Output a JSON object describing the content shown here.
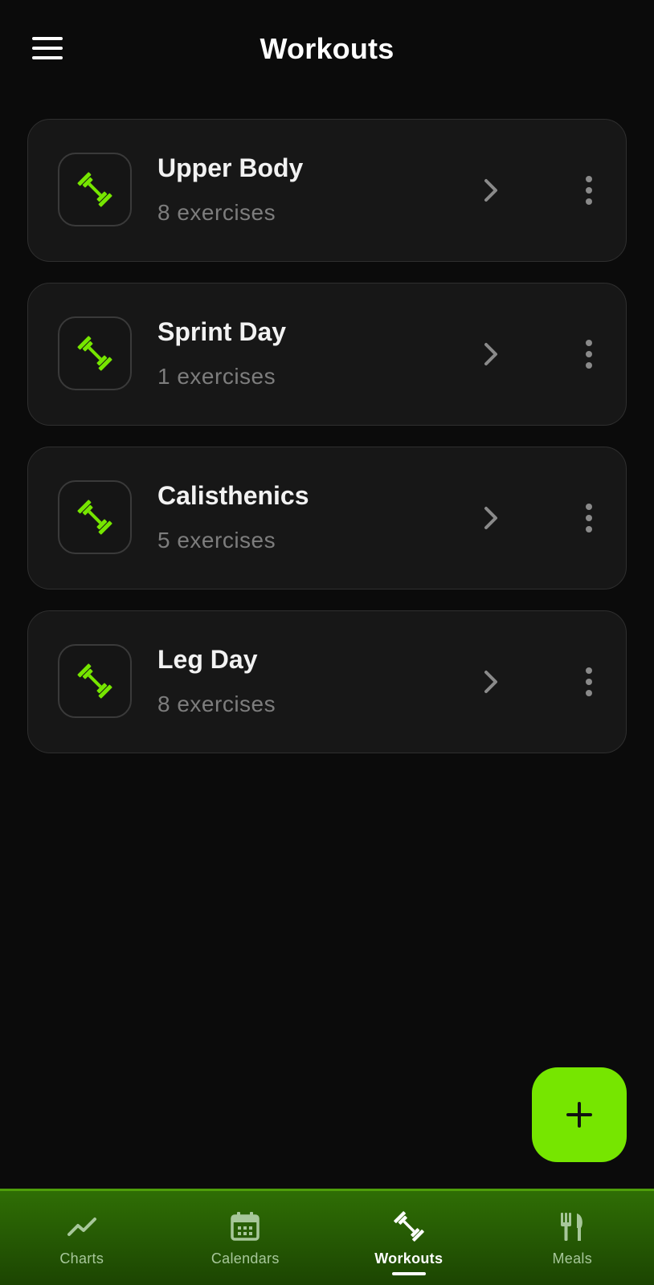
{
  "header": {
    "title": "Workouts",
    "menu_icon": "hamburger-menu-icon"
  },
  "workouts": [
    {
      "name": "Upper Body",
      "subtitle": "8 exercises"
    },
    {
      "name": "Sprint Day",
      "subtitle": "1 exercises"
    },
    {
      "name": "Calisthenics",
      "subtitle": "5 exercises"
    },
    {
      "name": "Leg Day",
      "subtitle": "8 exercises"
    }
  ],
  "fab": {
    "icon": "plus-icon"
  },
  "nav": {
    "items": [
      {
        "label": "Charts",
        "icon": "chart-line-icon"
      },
      {
        "label": "Calendars",
        "icon": "calendar-icon"
      },
      {
        "label": "Workouts",
        "icon": "dumbbell-icon",
        "active": true
      },
      {
        "label": "Meals",
        "icon": "fork-knife-icon"
      }
    ]
  },
  "colors": {
    "accent": "#76e600",
    "background": "#0b0b0b",
    "card": "#171717",
    "nav_bg": "#2f6e05"
  }
}
